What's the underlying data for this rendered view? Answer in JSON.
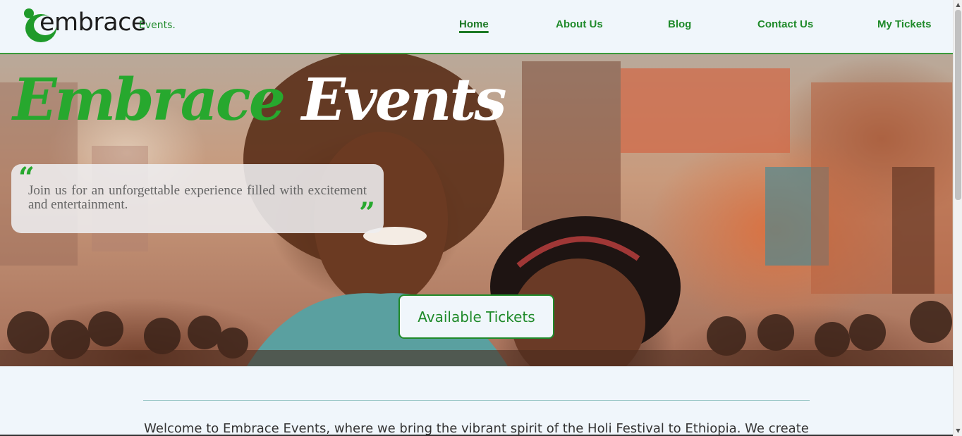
{
  "brand": {
    "name": "embrace",
    "suffix": "Events.",
    "accent": "#1f8a2a"
  },
  "nav": {
    "items": [
      {
        "label": "Home",
        "active": true
      },
      {
        "label": "About Us",
        "active": false
      },
      {
        "label": "Blog",
        "active": false
      },
      {
        "label": "Contact Us",
        "active": false
      },
      {
        "label": "My Tickets",
        "active": false
      }
    ]
  },
  "hero": {
    "title_green": "Embrace",
    "title_white": "Events",
    "quote_open": "“",
    "quote_close": "”",
    "quote": "Join us for an unforgettable experience filled with excitement and entertainment.",
    "cta": "Available Tickets"
  },
  "intro": {
    "text": "Welcome to Embrace Events, where we bring the vibrant spirit of the Holi Festival to Ethiopia. We create"
  }
}
